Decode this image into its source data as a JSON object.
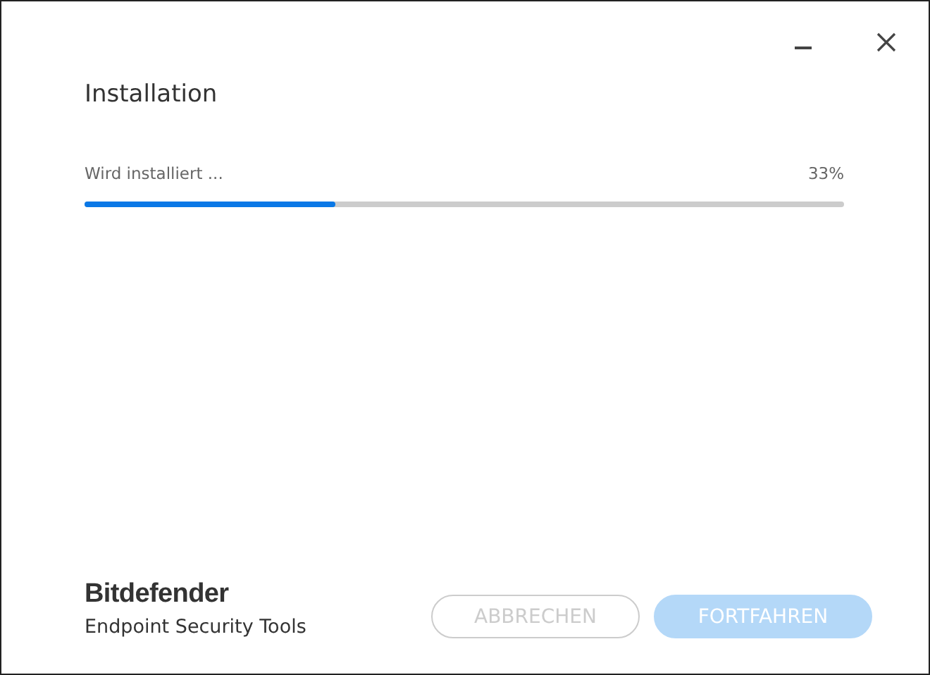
{
  "window": {
    "title": "Installation"
  },
  "progress": {
    "label": "Wird installiert ...",
    "reading": "33%",
    "level": 0.33
  },
  "brand": {
    "name": "Bitdefender",
    "product": "Endpoint Security Tools"
  },
  "buttons": [
    {
      "label": "ABBRECHEN",
      "kind": "outline",
      "disabled": true
    },
    {
      "label": "FORTFAHREN",
      "kind": "primary",
      "disabled": true
    }
  ]
}
